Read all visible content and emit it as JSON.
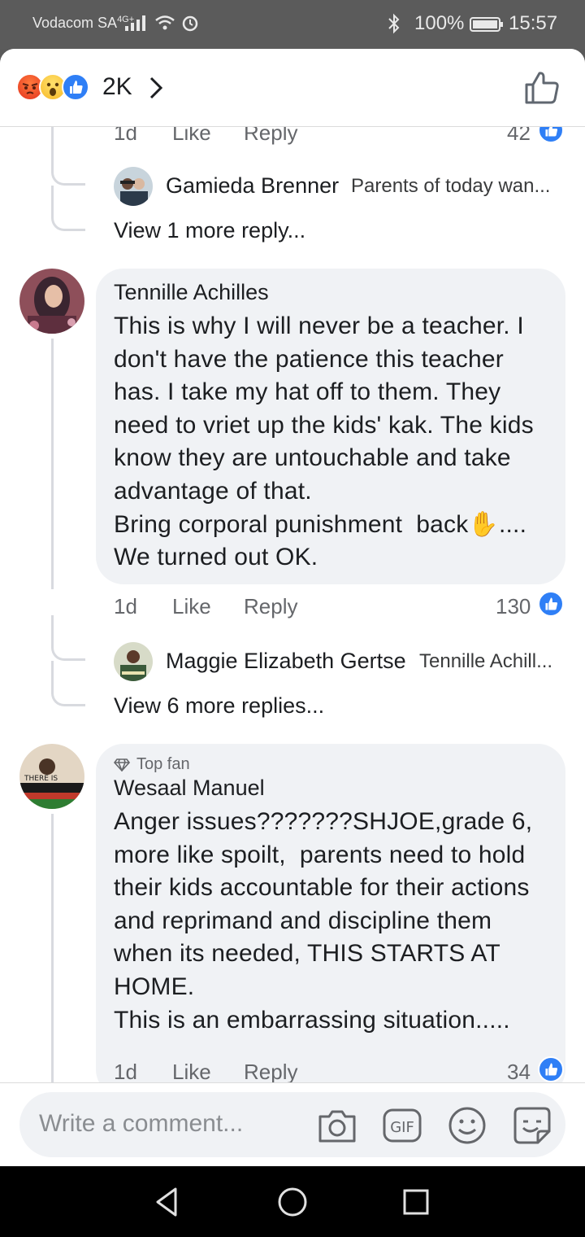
{
  "status_bar": {
    "carrier": "Vodacom SA",
    "network": "4G+",
    "battery_pct": "100%",
    "time": "15:57"
  },
  "header": {
    "reaction_icons": [
      "angry-emoji",
      "wow-emoji",
      "like-icon"
    ],
    "reaction_count": "2K",
    "chevron_icon": "chevron-right-icon",
    "like_icon": "thumbs-up-outline-icon"
  },
  "top_partial": {
    "time": "1d",
    "like_label": "Like",
    "reply_label": "Reply",
    "count": "42"
  },
  "first_reply_preview": {
    "name": "Gamieda Brenner",
    "text": "Parents of today wan..."
  },
  "first_view_more": "View 1 more reply...",
  "comments": [
    {
      "author": "Tennille Achilles",
      "body": "This is why I will never be a teacher. I don't have the patience this teacher has. I take my hat off to them. They need to vriet up the kids' kak. The kids know they are untouchable and take advantage of that.\nBring corporal punishment  back✋....\nWe turned out OK.",
      "time": "1d",
      "like_label": "Like",
      "reply_label": "Reply",
      "count": "130",
      "reply_preview": {
        "name": "Maggie Elizabeth Gertse",
        "text": "Tennille Achill..."
      },
      "view_more": "View 6 more replies..."
    },
    {
      "badge": "Top fan",
      "author": "Wesaal Manuel",
      "body": "Anger issues???????SHJOE,grade 6, more like spoilt,  parents need to hold their kids accountable for their actions and reprimand and discipline them when its needed, THIS STARTS AT HOME.\nThis is an embarrassing situation.....",
      "time": "1d",
      "like_label": "Like",
      "reply_label": "Reply",
      "count": "34"
    }
  ],
  "composer": {
    "placeholder": "Write a comment...",
    "icons": [
      "camera-icon",
      "gif-icon",
      "emoji-icon",
      "sticker-icon"
    ],
    "gif_label": "GIF"
  },
  "navbar": {
    "icons": [
      "back-icon",
      "home-icon",
      "recents-icon"
    ]
  },
  "colors": {
    "like_blue": "#2f7ff6",
    "bubble_bg": "#f0f2f5",
    "meta_gray": "#65676b"
  }
}
